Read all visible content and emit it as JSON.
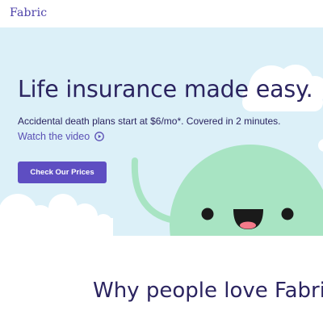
{
  "brand": {
    "logo_text": "Fabric"
  },
  "hero": {
    "headline": "Life insurance made easy.",
    "subheadline": "Accidental death plans start at $6/mo*. Covered in 2 minutes.",
    "watch_video_label": "Watch the video",
    "cta_label": "Check Our Prices",
    "illustration": "smiling-green-character-with-clouds"
  },
  "section": {
    "title": "Why people love Fabric"
  },
  "colors": {
    "brand_purple": "#5e4ec2",
    "navy_text": "#2b2460",
    "hero_background": "#dcf0f8",
    "character_green": "#a8e4c3"
  },
  "icons": {
    "watch_video": "play-circle-icon"
  }
}
